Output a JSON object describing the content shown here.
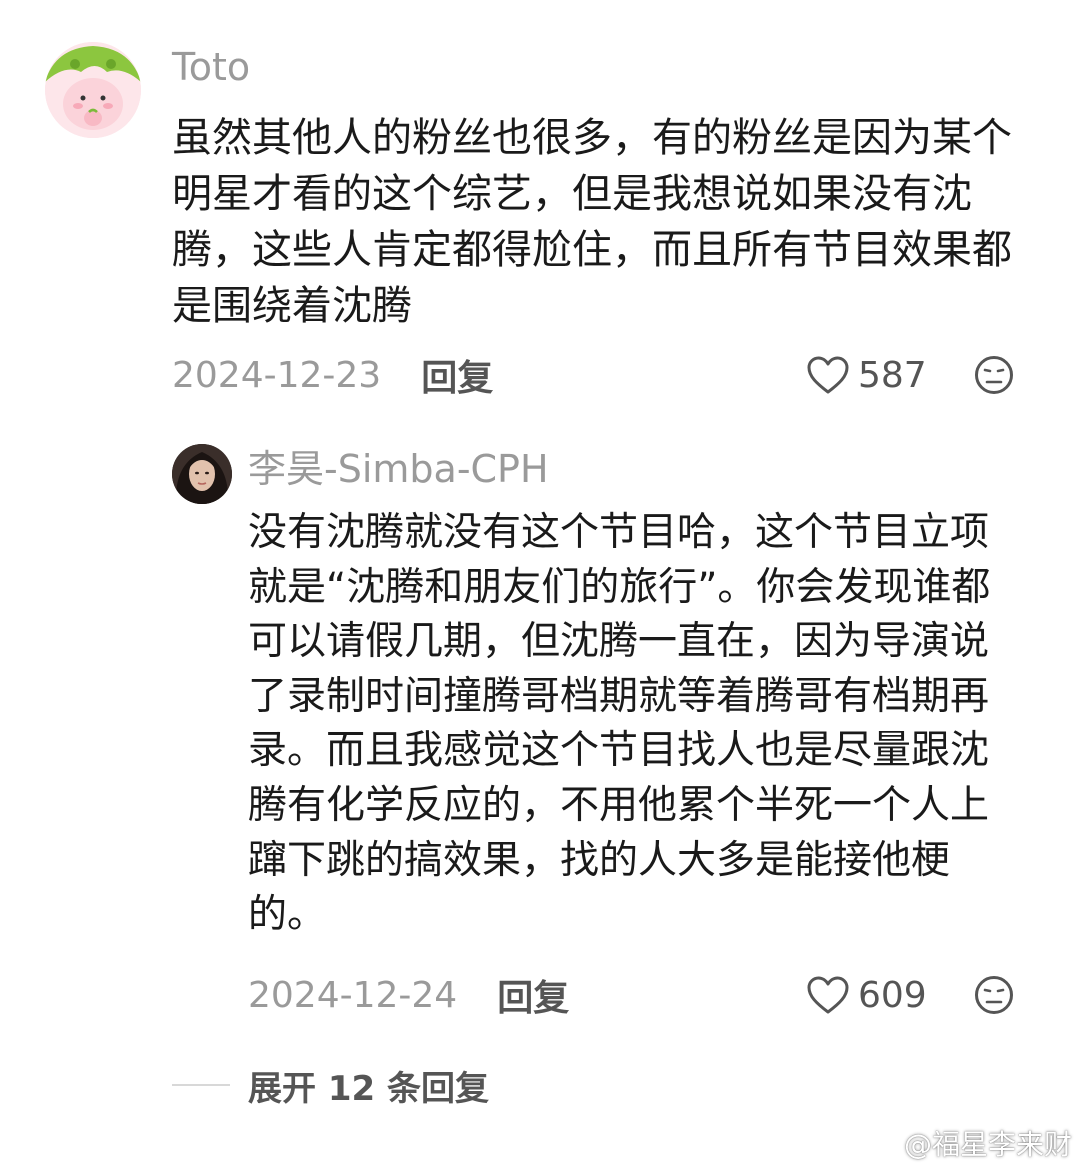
{
  "colors": {
    "username": "#9a9a9a",
    "text": "#1a1a1a",
    "meta": "#9a9a9a",
    "action": "#555555",
    "divider": "#d8d8d8"
  },
  "comment": {
    "username": "Toto",
    "text": "虽然其他人的粉丝也很多，有的粉丝是因为某个明星才看的这个综艺，但是我想说如果没有沈腾，这些人肯定都得尬住，而且所有节目效果都是围绕着沈腾",
    "date": "2024-12-23",
    "reply_label": "回复",
    "likes": "587",
    "like_icon": "heart-outline-icon",
    "dislike_icon": "meh-face-icon"
  },
  "reply": {
    "username": "李昊-Simba-CPH",
    "text": "没有沈腾就没有这个节目哈，这个节目立项就是“沈腾和朋友们的旅行”。你会发现谁都可以请假几期，但沈腾一直在，因为导演说了录制时间撞腾哥档期就等着腾哥有档期再录。而且我感觉这个节目找人也是尽量跟沈腾有化学反应的，不用他累个半死一个人上蹿下跳的搞效果，找的人大多是能接他梗的。",
    "date": "2024-12-24",
    "reply_label": "回复",
    "likes": "609",
    "like_icon": "heart-outline-icon",
    "dislike_icon": "meh-face-icon"
  },
  "expand": {
    "label": "展开 12 条回复"
  },
  "watermark": {
    "text": "@福星李来财",
    "icon": "weibo-logo-icon"
  }
}
